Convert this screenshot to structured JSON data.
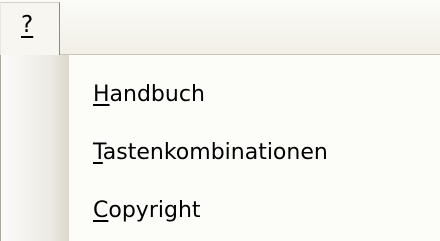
{
  "menubar": {
    "help_menu": {
      "label": "?"
    }
  },
  "dropdown": {
    "items": [
      {
        "mnemonic": "H",
        "rest": "andbuch",
        "label": "Handbuch"
      },
      {
        "mnemonic": "T",
        "rest": "astenkombinationen",
        "label": "Tastenkombinationen"
      },
      {
        "mnemonic": "C",
        "rest": "opyright",
        "label": "Copyright"
      }
    ]
  },
  "colors": {
    "menu_background": "#fcfcf9",
    "gutter_background": "#ecebe4",
    "border": "#aca899",
    "text": "#000000"
  }
}
